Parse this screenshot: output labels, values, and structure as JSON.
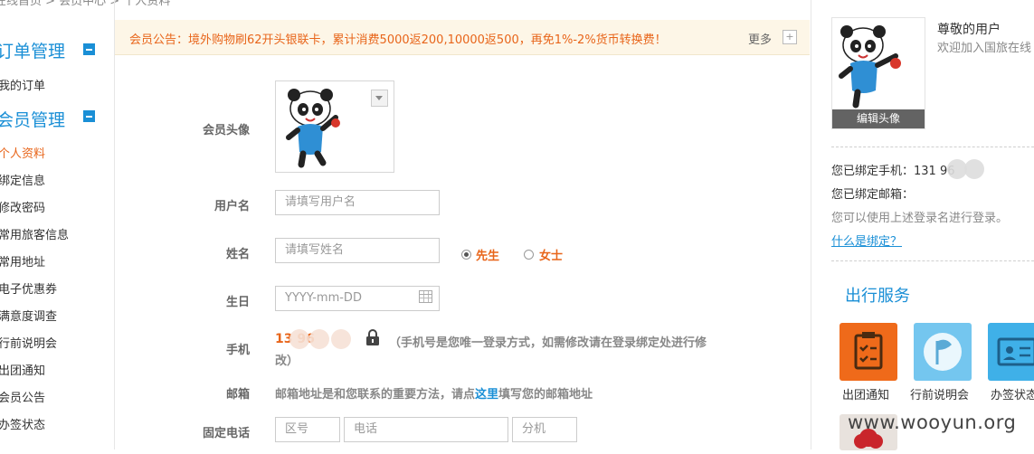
{
  "breadcrumb": "在线首页 > 会员中心 > 个人资料",
  "sidebar": {
    "section_orders": "订单管理",
    "item_my_orders": "我的订单",
    "section_member": "会员管理",
    "items": [
      "个人资料",
      "绑定信息",
      "修改密码",
      "常用旅客信息",
      "常用地址",
      "电子优惠券",
      "满意度调查",
      "行前说明会",
      "出团通知",
      "会员公告",
      "办签状态"
    ],
    "active_index": 0
  },
  "notice": {
    "text": "会员公告：境外购物刷62开头银联卡，累计消费5000返200,10000返500，再免1%-2%货币转换费！",
    "more": "更多",
    "plus": "+"
  },
  "form": {
    "avatar_label": "会员头像",
    "username_label": "用户名",
    "username_placeholder": "请填写用户名",
    "name_label": "姓名",
    "name_placeholder": "请填写姓名",
    "gender_male": "先生",
    "gender_female": "女士",
    "gender_selected": "先生",
    "birthday_label": "生日",
    "birthday_placeholder": "YYYY-mm-DD",
    "phone_label": "手机",
    "phone_value": "13      96",
    "phone_note": "（手机号是您唯一登录方式，如需修改请在登录绑定处进行修",
    "phone_note_cont": "改）",
    "email_label": "邮箱",
    "email_text_before": "邮箱地址是和您联系的重要方法，请点",
    "email_link": "这里",
    "email_text_after": "填写您的邮箱地址",
    "tel_label": "固定电话",
    "tel_area_placeholder": "区号",
    "tel_number_placeholder": "电话",
    "tel_ext_placeholder": "分机"
  },
  "right": {
    "edit_avatar": "编辑头像",
    "greeting": "尊敬的用户",
    "welcome": "欢迎加入国旅在线",
    "bound_phone": "您已绑定手机：131      96",
    "bound_email": "您已绑定邮箱：",
    "login_hint": "您可以使用上述登录名进行登录。",
    "what_is_binding": "什么是绑定？",
    "services_title": "出行服务",
    "services": [
      {
        "label": "出团通知",
        "icon": "clipboard-check-icon",
        "color": "#ef6a1a"
      },
      {
        "label": "行前说明会",
        "icon": "flag-icon",
        "color": "#74c6ef"
      },
      {
        "label": "办签状态",
        "icon": "id-card-icon",
        "color": "#3fb0e8"
      }
    ]
  },
  "watermark": "www.wooyun.org"
}
